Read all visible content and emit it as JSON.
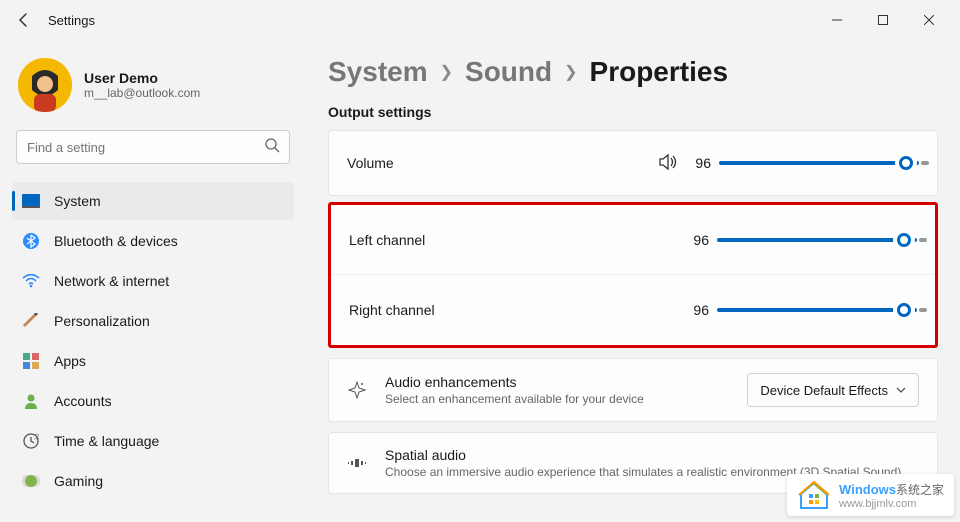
{
  "window": {
    "title": "Settings"
  },
  "user": {
    "name": "User Demo",
    "email": "m__lab@outlook.com"
  },
  "search": {
    "placeholder": "Find a setting"
  },
  "nav": {
    "items": [
      {
        "label": "System"
      },
      {
        "label": "Bluetooth & devices"
      },
      {
        "label": "Network & internet"
      },
      {
        "label": "Personalization"
      },
      {
        "label": "Apps"
      },
      {
        "label": "Accounts"
      },
      {
        "label": "Time & language"
      },
      {
        "label": "Gaming"
      }
    ]
  },
  "breadcrumb": {
    "a": "System",
    "b": "Sound",
    "c": "Properties"
  },
  "section": {
    "output_settings": "Output settings"
  },
  "sound": {
    "volume_label": "Volume",
    "volume_value": "96",
    "left_label": "Left channel",
    "left_value": "96",
    "right_label": "Right channel",
    "right_value": "96"
  },
  "enhance": {
    "title": "Audio enhancements",
    "desc": "Select an enhancement available for your device",
    "dropdown": "Device Default Effects"
  },
  "spatial": {
    "title": "Spatial audio",
    "desc": "Choose an immersive audio experience that simulates a realistic environment (3D Spatial Sound)"
  },
  "watermark": {
    "brand": "Windows",
    "sub": "系统之家",
    "url": "www.bjjmlv.com"
  }
}
